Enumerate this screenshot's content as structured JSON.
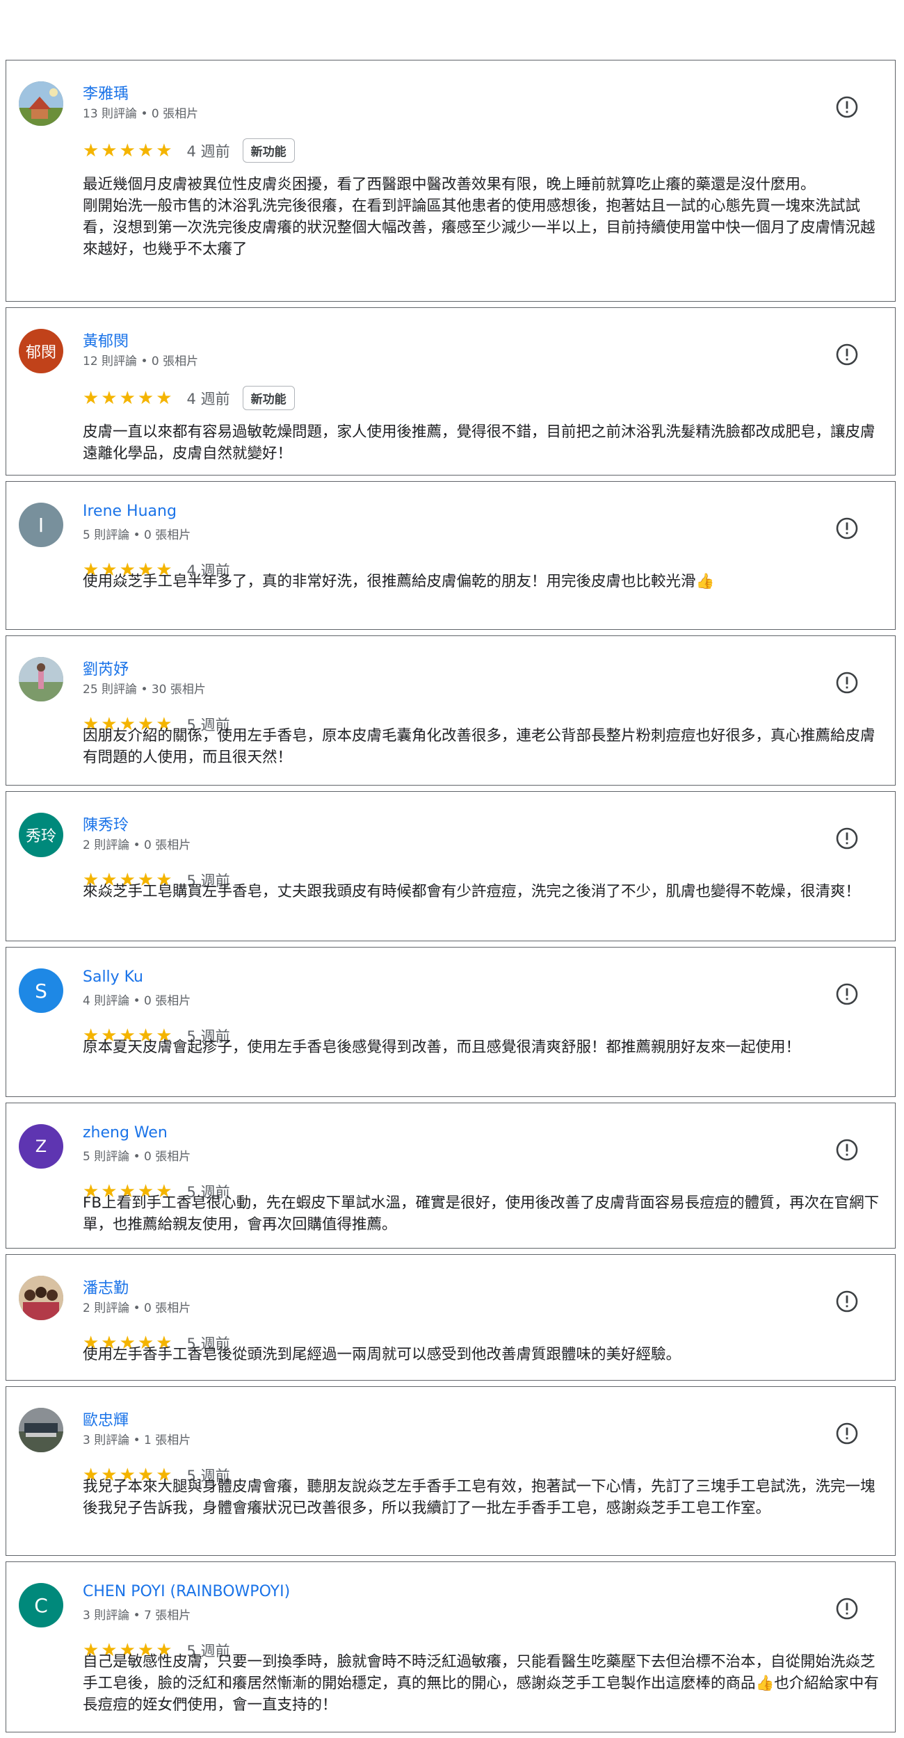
{
  "reviews": [
    {
      "name": "李雅瑀",
      "meta": "13 則評論 • 0 張相片",
      "stars": "★★★★★",
      "age": "4 週前",
      "badge": "新功能",
      "text": "最近幾個月皮膚被異位性皮膚炎困擾，看了西醫跟中醫改善效果有限，晚上睡前就算吃止癢的藥還是沒什麼用。\n剛開始洗一般市售的沐浴乳洗完後很癢，在看到評論區其他患者的使用感想後，抱著姑且一試的心態先買一塊來洗試試看，沒想到第一次洗完後皮膚癢的狀況整個大幅改善，癢感至少減少一半以上，目前持續使用當中快一個月了皮膚情況越來越好，也幾乎不太癢了",
      "avatar": {
        "type": "photo",
        "color": "#7f9cbf"
      }
    },
    {
      "name": "黃郁閔",
      "meta": "12 則評論 • 0 張相片",
      "stars": "★★★★★",
      "age": "4 週前",
      "badge": "新功能",
      "text": "皮膚一直以來都有容易過敏乾燥問題，家人使用後推薦，覺得很不錯，目前把之前沐浴乳洗髮精洗臉都改成肥皂，讓皮膚遠離化學品，皮膚自然就變好！",
      "avatar": {
        "type": "text",
        "letter": "郁閔",
        "color": "#c1421a"
      }
    },
    {
      "name": "Irene Huang",
      "meta": "5 則評論 • 0 張相片",
      "stars": "★★★★★",
      "age": "4 週前",
      "text": "使用焱芝手工皂半年多了，真的非常好洗，很推薦給皮膚偏乾的朋友！用完後皮膚也比較光滑👍",
      "avatar": {
        "type": "text",
        "letter": "I",
        "color": "#78909c"
      }
    },
    {
      "name": "劉芮妤",
      "meta": "25 則評論 • 30 張相片",
      "stars": "★★★★★",
      "age": "5 週前",
      "text": "因朋友介紹的關係，使用左手香皂，原本皮膚毛囊角化改善很多，連老公背部長整片粉刺痘痘也好很多，真心推薦給皮膚有問題的人使用，而且很天然！",
      "avatar": {
        "type": "photo",
        "color": "#8fa6b6"
      }
    },
    {
      "name": "陳秀玲",
      "meta": "2 則評論 • 0 張相片",
      "stars": "★★★★★",
      "age": "5 週前",
      "text": "來焱芝手工皂購買左手香皂，丈夫跟我頭皮有時候都會有少許痘痘，洗完之後消了不少，肌膚也變得不乾燥，很清爽！",
      "avatar": {
        "type": "text",
        "letter": "秀玲",
        "color": "#00897b"
      }
    },
    {
      "name": "Sally Ku",
      "meta": "4 則評論 • 0 張相片",
      "stars": "★★★★★",
      "age": "5 週前",
      "text": "原本夏天皮膚會起疹子，使用左手香皂後感覺得到改善，而且感覺很清爽舒服！都推薦親朋好友來一起使用！",
      "avatar": {
        "type": "text",
        "letter": "S",
        "color": "#1e88e5"
      }
    },
    {
      "name": "zheng Wen",
      "meta": "5 則評論 • 0 張相片",
      "stars": "★★★★★",
      "age": "5 週前",
      "text": "FB上看到手工香皂很心動，先在蝦皮下單試水溫，確實是很好，使用後改善了皮膚背面容易長痘痘的體質，再次在官網下單，也推薦給親友使用，會再次回購值得推薦。",
      "avatar": {
        "type": "text",
        "letter": "Z",
        "color": "#5e35b1"
      }
    },
    {
      "name": "潘志勤",
      "meta": "2 則評論 • 0 張相片",
      "stars": "★★★★★",
      "age": "5 週前",
      "text": "使用左手香手工香皂後從頭洗到尾經過一兩周就可以感受到他改善膚質跟體味的美好經驗。",
      "avatar": {
        "type": "photo",
        "color": "#a0522d"
      }
    },
    {
      "name": "歐忠輝",
      "meta": "3 則評論 • 1 張相片",
      "stars": "★★★★★",
      "age": "5 週前",
      "text": "我兒子本來大腿與身體皮膚會癢，聽朋友說焱芝左手香手工皂有效，抱著試一下心情，先訂了三塊手工皂試洗，洗完一塊後我兒子告訴我，身體會癢狀況已改善很多，所以我續訂了一批左手香手工皂，感謝焱芝手工皂工作室。",
      "avatar": {
        "type": "photo",
        "color": "#6d6d6d"
      }
    },
    {
      "name": "CHEN POYI (RAINBOWPOYI)",
      "meta": "3 則評論 • 7 張相片",
      "stars": "★★★★★",
      "age": "5 週前",
      "text": "自己是敏感性皮膚，只要一到換季時，臉就會時不時泛紅過敏癢，只能看醫生吃藥壓下去但治標不治本，自從開始洗焱芝手工皂後，臉的泛紅和癢居然慚漸的開始穩定，真的無比的開心，感謝焱芝手工皂製作出這麼棒的商品👍也介紹給家中有長痘痘的姪女們使用，會一直支持的！",
      "avatar": {
        "type": "text",
        "letter": "C",
        "color": "#00897b"
      }
    }
  ]
}
